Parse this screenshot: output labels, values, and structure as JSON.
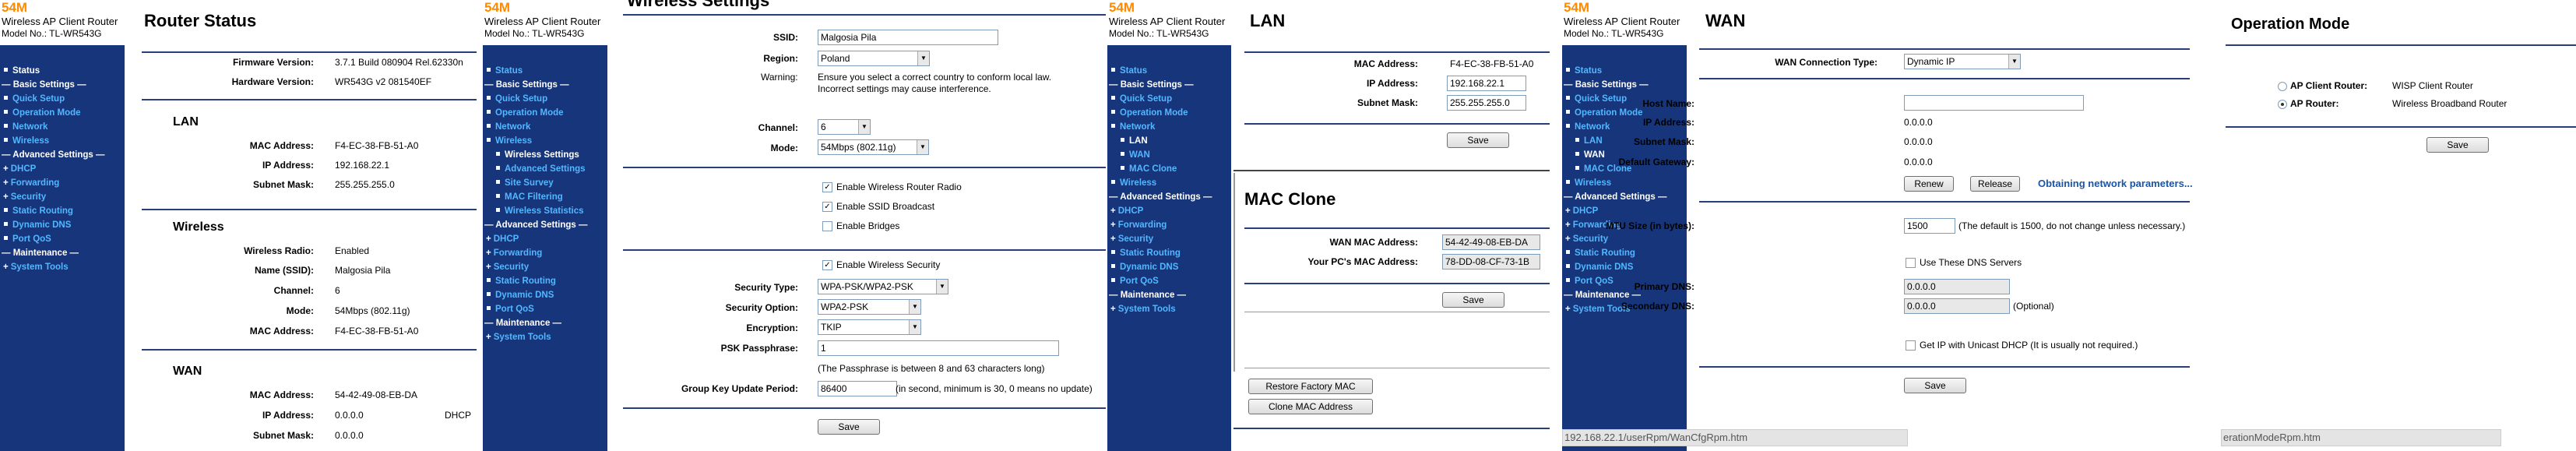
{
  "brand": {
    "model_speed": "54M",
    "title": "Wireless AP Client Router",
    "model_no": "Model No.: TL-WR543G"
  },
  "panel1": {
    "menu": [
      {
        "t": "Status",
        "c": "w",
        "k": "b"
      },
      {
        "t": "— Basic Settings —",
        "c": "sep"
      },
      {
        "t": "Quick Setup",
        "k": "b"
      },
      {
        "t": "Operation Mode",
        "k": "b"
      },
      {
        "t": "Network",
        "k": "b"
      },
      {
        "t": "Wireless",
        "k": "b"
      },
      {
        "t": "— Advanced Settings —",
        "c": "sep"
      },
      {
        "t": "DHCP",
        "k": "a"
      },
      {
        "t": "Forwarding",
        "k": "a"
      },
      {
        "t": "Security",
        "k": "a"
      },
      {
        "t": "Static Routing",
        "k": "b"
      },
      {
        "t": "Dynamic DNS",
        "k": "b"
      },
      {
        "t": "Port QoS",
        "k": "b"
      },
      {
        "t": "— Maintenance —",
        "c": "sep"
      },
      {
        "t": "System Tools",
        "k": "a"
      }
    ],
    "title": "Router Status",
    "firmware_label": "Firmware Version:",
    "firmware": "3.7.1 Build 080904 Rel.62330n",
    "hardware_label": "Hardware Version:",
    "hardware": "WR543G v2 081540EF",
    "lan_title": "LAN",
    "lan_mac_label": "MAC Address:",
    "lan_mac": "F4-EC-38-FB-51-A0",
    "lan_ip_label": "IP Address:",
    "lan_ip": "192.168.22.1",
    "lan_mask_label": "Subnet Mask:",
    "lan_mask": "255.255.255.0",
    "wl_title": "Wireless",
    "wl_radio_label": "Wireless Radio:",
    "wl_radio": "Enabled",
    "wl_ssid_label": "Name (SSID):",
    "wl_ssid": "Malgosia Pila",
    "wl_channel_label": "Channel:",
    "wl_channel": "6",
    "wl_mode_label": "Mode:",
    "wl_mode": "54Mbps (802.11g)",
    "wl_mac_label": "MAC Address:",
    "wl_mac": "F4-EC-38-FB-51-A0",
    "wan_title": "WAN",
    "wan_mac_label": "MAC Address:",
    "wan_mac": "54-42-49-08-EB-DA",
    "wan_ip_label": "IP Address:",
    "wan_ip": "0.0.0.0",
    "wan_type": "DHCP",
    "wan_mask_label": "Subnet Mask:",
    "wan_mask": "0.0.0.0"
  },
  "panel2": {
    "menu": [
      {
        "t": "Status",
        "k": "b"
      },
      {
        "t": "— Basic Settings —",
        "c": "sep"
      },
      {
        "t": "Quick Setup",
        "k": "b"
      },
      {
        "t": "Operation Mode",
        "k": "b"
      },
      {
        "t": "Network",
        "k": "b"
      },
      {
        "t": "Wireless",
        "k": "b"
      },
      {
        "t": "Wireless Settings",
        "c": "w",
        "s": 1,
        "k": "b"
      },
      {
        "t": "Advanced Settings",
        "s": 1,
        "k": "b"
      },
      {
        "t": "Site Survey",
        "s": 1,
        "k": "b"
      },
      {
        "t": "MAC Filtering",
        "s": 1,
        "k": "b"
      },
      {
        "t": "Wireless Statistics",
        "s": 1,
        "k": "b"
      },
      {
        "t": "— Advanced Settings —",
        "c": "sep"
      },
      {
        "t": "DHCP",
        "k": "a"
      },
      {
        "t": "Forwarding",
        "k": "a"
      },
      {
        "t": "Security",
        "k": "a"
      },
      {
        "t": "Static Routing",
        "k": "b"
      },
      {
        "t": "Dynamic DNS",
        "k": "b"
      },
      {
        "t": "Port QoS",
        "k": "b"
      },
      {
        "t": "— Maintenance —",
        "c": "sep"
      },
      {
        "t": "System Tools",
        "k": "a"
      }
    ],
    "title": "Wireless Settings",
    "ssid_label": "SSID:",
    "ssid": "Malgosia Pila",
    "region_label": "Region:",
    "region": "Poland",
    "warning_label": "Warning:",
    "warning1": "Ensure you select a correct country to conform local law.",
    "warning2": "Incorrect settings may cause interference.",
    "channel_label": "Channel:",
    "channel": "6",
    "mode_label": "Mode:",
    "mode": "54Mbps (802.11g)",
    "cb_radio": "Enable Wireless Router Radio",
    "cb_ssid": "Enable SSID Broadcast",
    "cb_bridges": "Enable Bridges",
    "cb_security": "Enable Wireless Security",
    "sec_type_label": "Security Type:",
    "sec_type": "WPA-PSK/WPA2-PSK",
    "sec_opt_label": "Security Option:",
    "sec_opt": "WPA2-PSK",
    "enc_label": "Encryption:",
    "enc": "TKIP",
    "psk_label": "PSK Passphrase:",
    "psk": "1",
    "psk_note": "(The Passphrase is between 8 and 63 characters long)",
    "gk_label": "Group Key Update Period:",
    "gk": "86400",
    "gk_note": "(in second, minimum is 30, 0 means no update)",
    "save": "Save"
  },
  "panel3": {
    "menu": [
      {
        "t": "Status",
        "k": "b"
      },
      {
        "t": "— Basic Settings —",
        "c": "sep"
      },
      {
        "t": "Quick Setup",
        "k": "b"
      },
      {
        "t": "Operation Mode",
        "k": "b"
      },
      {
        "t": "Network",
        "k": "b"
      },
      {
        "t": "LAN",
        "c": "w",
        "s": 1,
        "k": "b"
      },
      {
        "t": "WAN",
        "s": 1,
        "k": "b"
      },
      {
        "t": "MAC Clone",
        "s": 1,
        "k": "b"
      },
      {
        "t": "Wireless",
        "k": "b"
      },
      {
        "t": "— Advanced Settings —",
        "c": "sep"
      },
      {
        "t": "DHCP",
        "k": "a"
      },
      {
        "t": "Forwarding",
        "k": "a"
      },
      {
        "t": "Security",
        "k": "a"
      },
      {
        "t": "Static Routing",
        "k": "b"
      },
      {
        "t": "Dynamic DNS",
        "k": "b"
      },
      {
        "t": "Port QoS",
        "k": "b"
      },
      {
        "t": "— Maintenance —",
        "c": "sep"
      },
      {
        "t": "System Tools",
        "k": "a"
      }
    ],
    "lan_title": "LAN",
    "mac_label": "MAC Address:",
    "mac": "F4-EC-38-FB-51-A0",
    "ip_label": "IP Address:",
    "ip": "192.168.22.1",
    "mask_label": "Subnet Mask:",
    "mask": "255.255.255.0",
    "save": "Save",
    "clone_title": "MAC Clone",
    "wan_mac_label": "WAN MAC Address:",
    "wan_mac": "54-42-49-08-EB-DA",
    "pc_mac_label": "Your PC's MAC Address:",
    "pc_mac": "78-DD-08-CF-73-1B",
    "save2": "Save",
    "restore": "Restore Factory MAC",
    "clone": "Clone MAC Address"
  },
  "panel4": {
    "menu": [
      {
        "t": "Status",
        "k": "b"
      },
      {
        "t": "— Basic Settings —",
        "c": "sep"
      },
      {
        "t": "Quick Setup",
        "k": "b"
      },
      {
        "t": "Operation Mode",
        "k": "b"
      },
      {
        "t": "Network",
        "k": "b"
      },
      {
        "t": "LAN",
        "s": 1,
        "k": "b"
      },
      {
        "t": "WAN",
        "c": "w",
        "s": 1,
        "k": "b"
      },
      {
        "t": "MAC Clone",
        "s": 1,
        "k": "b"
      },
      {
        "t": "Wireless",
        "k": "b"
      },
      {
        "t": "— Advanced Settings —",
        "c": "sep"
      },
      {
        "t": "DHCP",
        "k": "a"
      },
      {
        "t": "Forwarding",
        "k": "a"
      },
      {
        "t": "Security",
        "k": "a"
      },
      {
        "t": "Static Routing",
        "k": "b"
      },
      {
        "t": "Dynamic DNS",
        "k": "b"
      },
      {
        "t": "Port QoS",
        "k": "b"
      },
      {
        "t": "— Maintenance —",
        "c": "sep"
      },
      {
        "t": "System Tools",
        "k": "a"
      }
    ],
    "title": "WAN",
    "conn_label": "WAN Connection Type:",
    "conn": "Dynamic IP",
    "host_label": "Host Name:",
    "host": "",
    "ip_label": "IP Address:",
    "ip": "0.0.0.0",
    "mask_label": "Subnet Mask:",
    "mask": "0.0.0.0",
    "gw_label": "Default Gateway:",
    "gw": "0.0.0.0",
    "renew": "Renew",
    "release": "Release",
    "obtaining": "Obtaining network parameters...",
    "mtu_label": "MTU Size (in bytes):",
    "mtu": "1500",
    "mtu_note": "(The default is 1500, do not change unless necessary.)",
    "use_dns": "Use These DNS Servers",
    "pdns_label": "Primary DNS:",
    "pdns": "0.0.0.0",
    "sdns_label": "Secondary DNS:",
    "sdns": "0.0.0.0",
    "optional": "(Optional)",
    "unicast": "Get IP with Unicast DHCP (It is usually not required.)",
    "save": "Save",
    "statusbar": "192.168.22.1/userRpm/WanCfgRpm.htm"
  },
  "panel5": {
    "title": "Operation Mode",
    "client_label": "AP Client Router:",
    "client_desc": "WISP Client Router",
    "ap_label": "AP Router:",
    "ap_desc": "Wireless Broadband Router",
    "save": "Save",
    "statusbar": "erationModeRpm.htm"
  }
}
